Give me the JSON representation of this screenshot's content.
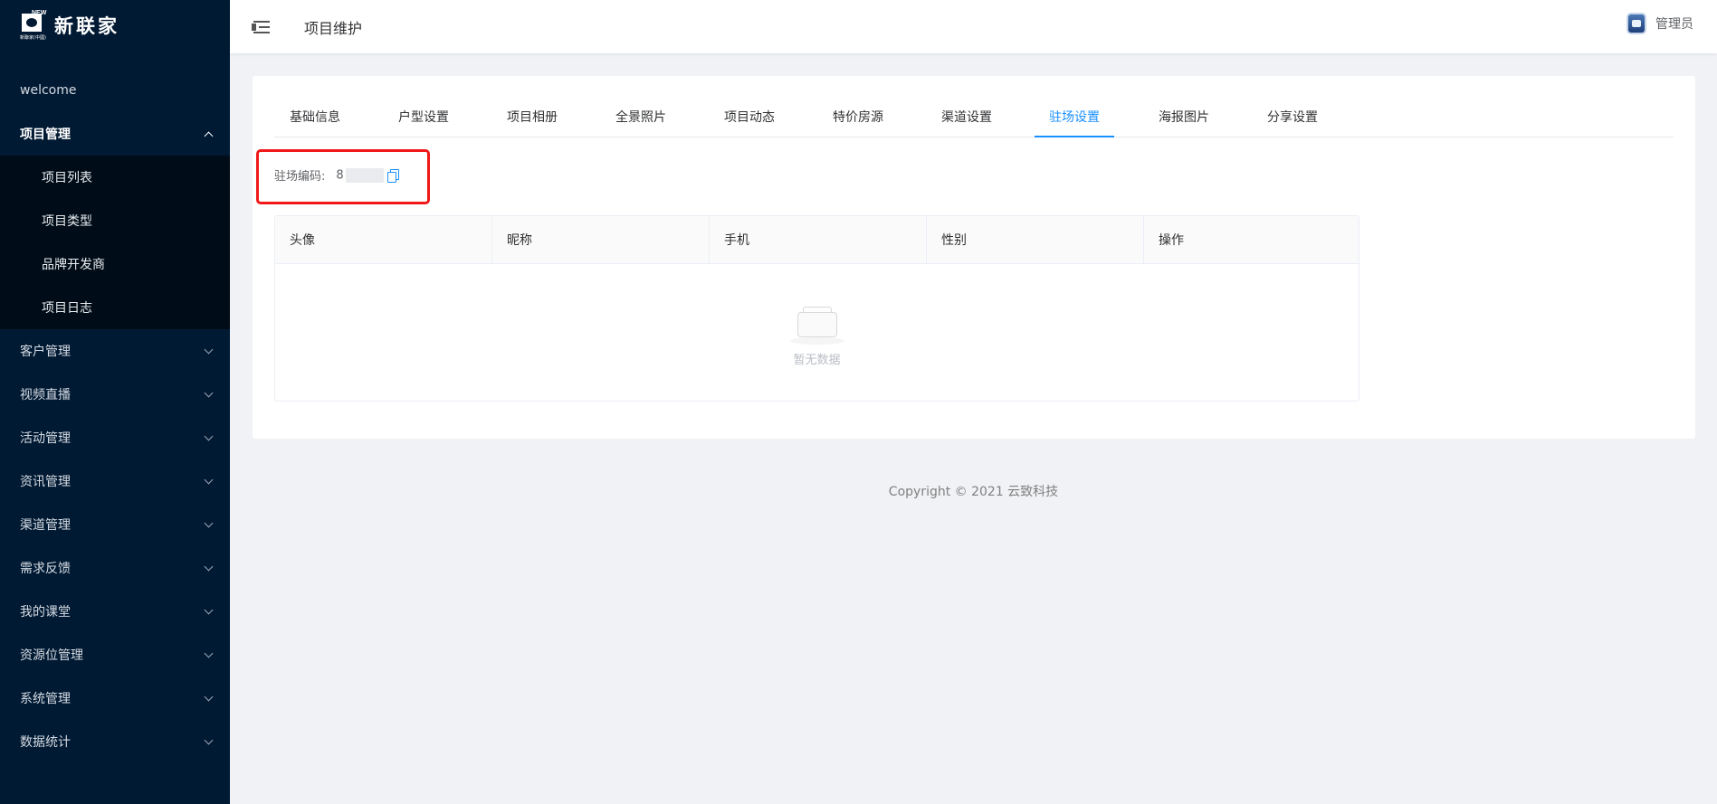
{
  "brand": {
    "name": "新联家",
    "mark_tag": "NEW",
    "mark_sub": "新聯家(中國)"
  },
  "sidebar": {
    "items": [
      {
        "label": "welcome"
      },
      {
        "label": "项目管理",
        "expanded": true,
        "children": [
          {
            "label": "项目列表"
          },
          {
            "label": "项目类型"
          },
          {
            "label": "品牌开发商"
          },
          {
            "label": "项目日志"
          }
        ]
      },
      {
        "label": "客户管理"
      },
      {
        "label": "视频直播"
      },
      {
        "label": "活动管理"
      },
      {
        "label": "资讯管理"
      },
      {
        "label": "渠道管理"
      },
      {
        "label": "需求反馈"
      },
      {
        "label": "我的课堂"
      },
      {
        "label": "资源位管理"
      },
      {
        "label": "系统管理"
      },
      {
        "label": "数据统计"
      }
    ]
  },
  "header": {
    "title": "项目维护",
    "user": "管理员"
  },
  "tabs": [
    {
      "label": "基础信息"
    },
    {
      "label": "户型设置"
    },
    {
      "label": "项目相册"
    },
    {
      "label": "全景照片"
    },
    {
      "label": "项目动态"
    },
    {
      "label": "特价房源"
    },
    {
      "label": "渠道设置"
    },
    {
      "label": "驻场设置",
      "active": true
    },
    {
      "label": "海报图片"
    },
    {
      "label": "分享设置"
    }
  ],
  "field": {
    "label": "驻场编码:",
    "value": "8"
  },
  "table": {
    "columns": [
      "头像",
      "昵称",
      "手机",
      "性别",
      "操作"
    ],
    "empty_text": "暂无数据"
  },
  "footer": {
    "text": "Copyright © 2021 云致科技"
  },
  "colors": {
    "sidebar_bg": "#011a33",
    "accent": "#1890ff",
    "highlight": "#f01818"
  }
}
